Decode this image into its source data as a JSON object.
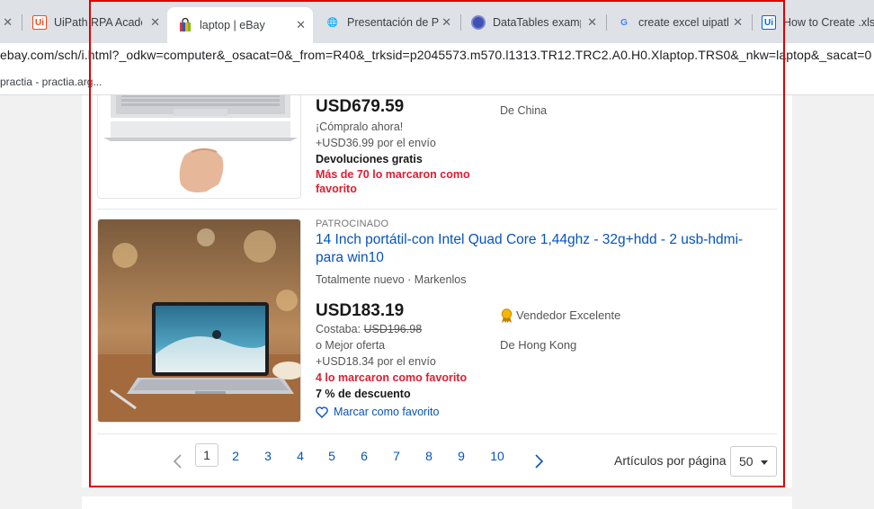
{
  "browser": {
    "tabs": [
      {
        "label": "",
        "icon": "close-icon"
      },
      {
        "label": "UiPath RPA Acade",
        "icon": "uipath-icon"
      },
      {
        "label": "laptop | eBay",
        "icon": "ebay-bag-icon",
        "active": true
      },
      {
        "label": "Presentación de Po",
        "icon": "globe-icon"
      },
      {
        "label": "DataTables examp",
        "icon": "datatables-icon"
      },
      {
        "label": "create excel uipath",
        "icon": "google-icon"
      },
      {
        "label": "How to Create .xls",
        "icon": "uipath-icon"
      }
    ],
    "url": "ebay.com/sch/i.html?_odkw=computer&_osacat=0&_from=R40&_trksid=p2045573.m570.l1313.TR12.TRC2.A0.H0.Xlaptop.TRS0&_nkw=laptop&_sacat=0",
    "bookmark": "practia - practia.arg..."
  },
  "listings": [
    {
      "price": "USD679.59",
      "buy_now": "¡Cómpralo ahora!",
      "shipping": "+USD36.99 por el envío",
      "returns": "Devoluciones gratis",
      "watchers": "Más de 70 lo marcaron como favorito",
      "location": "De China"
    },
    {
      "sponsored": "PATROCINADO",
      "title": "14 Inch portátil-con Intel Quad Core 1,44ghz - 32g+hdd - 2 usb-hdmi-para win10",
      "condition": "Totalmente nuevo · Markenlos",
      "price": "USD183.19",
      "was_label": "Costaba:",
      "was_price": "USD196.98",
      "best_offer": "o Mejor oferta",
      "shipping": "+USD18.34 por el envío",
      "watchers": "4 lo marcaron como favorito",
      "discount": "7 % de descuento",
      "watch_link": "Marcar como favorito",
      "seller_badge": "Vendedor Excelente",
      "location": "De Hong Kong"
    }
  ],
  "pagination": {
    "pages": [
      "1",
      "2",
      "3",
      "4",
      "5",
      "6",
      "7",
      "8",
      "9",
      "10"
    ],
    "current": "1",
    "per_page_label": "Artículos por página",
    "per_page_value": "50"
  },
  "colors": {
    "highlight": "#e00000",
    "link": "#0654ba",
    "watch_red": "#dd1e31"
  }
}
